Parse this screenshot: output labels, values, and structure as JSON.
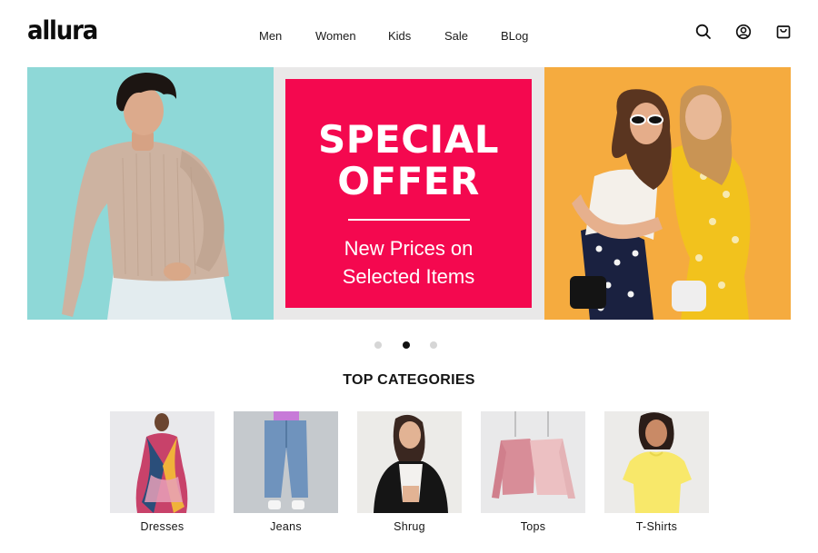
{
  "brand": {
    "logo_text": "allura"
  },
  "nav": {
    "items": [
      "Men",
      "Women",
      "Kids",
      "Sale",
      "BLog"
    ]
  },
  "header_icons": [
    "search-icon",
    "account-icon",
    "cart-bag-icon"
  ],
  "hero": {
    "offer_title_line1": "SPECIAL",
    "offer_title_line2": "OFFER",
    "offer_sub_line1": "New Prices on",
    "offer_sub_line2": "Selected Items",
    "colors": {
      "left_bg": "#8ed8d7",
      "offer_bg": "#f4084f",
      "right_bg": "#f5ab3f"
    },
    "carousel": {
      "slides": 3,
      "active_index": 2
    }
  },
  "categories": {
    "title": "TOP CATEGORIES",
    "items": [
      {
        "label": "Dresses"
      },
      {
        "label": "Jeans"
      },
      {
        "label": "Shrug"
      },
      {
        "label": "Tops"
      },
      {
        "label": "T-Shirts"
      }
    ]
  }
}
